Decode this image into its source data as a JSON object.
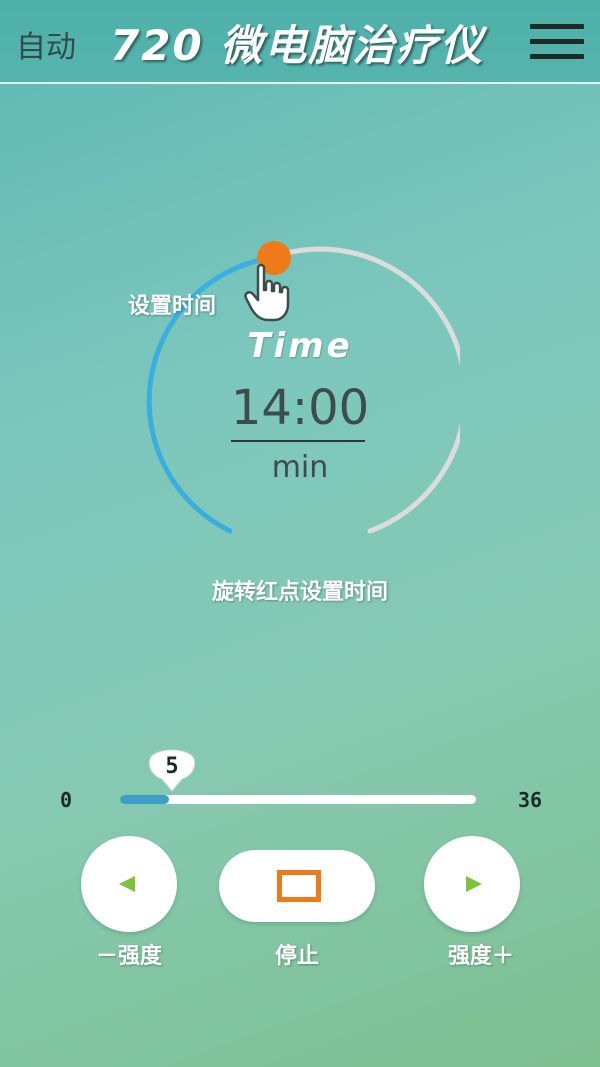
{
  "header": {
    "mode_label": "自动",
    "title": "720 微电脑治疗仪",
    "menu_icon": "hamburger-menu-icon"
  },
  "timer": {
    "label": "Time",
    "value": "14:00",
    "unit": "min",
    "set_time_label": "设置时间",
    "hint": "旋转红点设置时间",
    "progress_color": "#3aaee0",
    "track_color": "#dcdcdc",
    "handle_color": "#ee7a1a",
    "hand_icon": "pointing-hand-icon"
  },
  "intensity": {
    "min_label": "0",
    "max_label": "36",
    "min": 0,
    "max": 36,
    "value": 5,
    "value_label": "5",
    "fill_color": "#3d9fc8"
  },
  "controls": {
    "decrease_label": "－强度",
    "stop_label": "停止",
    "increase_label": "强度＋",
    "arrow_color": "#7cc23a",
    "stop_color": "#ee7a1a"
  }
}
